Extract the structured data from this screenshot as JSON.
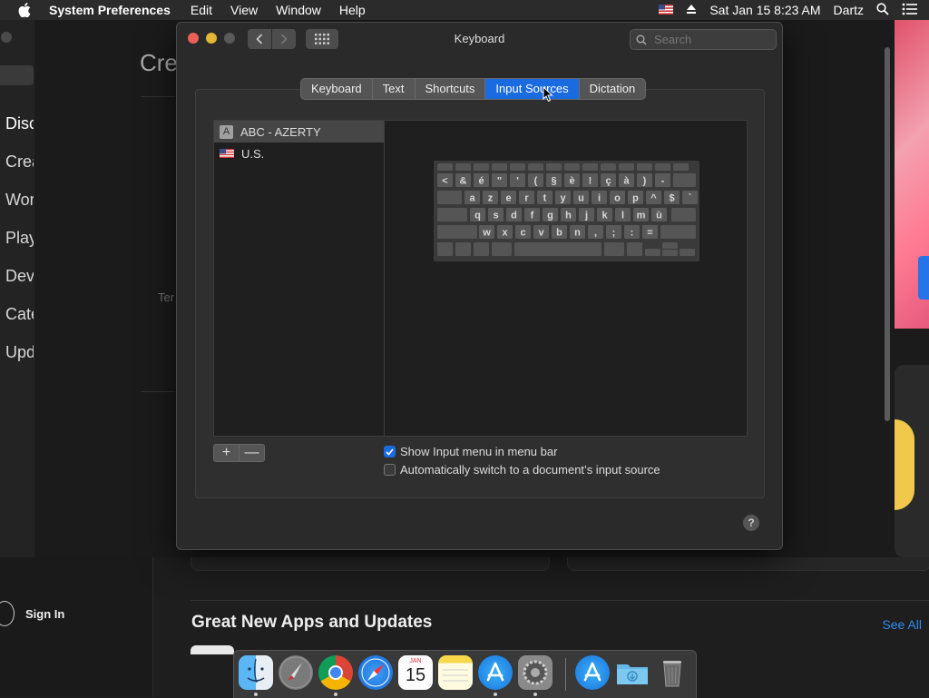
{
  "menubar": {
    "app_name": "System Preferences",
    "items": [
      "Edit",
      "View",
      "Window",
      "Help"
    ],
    "datetime": "Sat Jan 15  8:23 AM",
    "user": "Dartz"
  },
  "background_app": {
    "title_partial": "Cre",
    "nav_items": [
      "Disc",
      "Crea",
      "Wor",
      "Play",
      "Dev",
      "Cate",
      "Upd"
    ],
    "text_partial": "Ter",
    "sign_in": "Sign In",
    "section_title": "Great New Apps and Updates",
    "see_all": "See All"
  },
  "window": {
    "title": "Keyboard",
    "search_placeholder": "Search",
    "tabs": [
      "Keyboard",
      "Text",
      "Shortcuts",
      "Input Sources",
      "Dictation"
    ],
    "active_tab": "Input Sources",
    "input_sources": [
      {
        "label": "ABC - AZERTY",
        "icon": "letter-a-icon",
        "selected": true
      },
      {
        "label": "U.S.",
        "icon": "us-flag-icon",
        "selected": false
      }
    ],
    "add_label": "+",
    "remove_label": "—",
    "show_input_menu": {
      "label": "Show Input menu in menu bar",
      "checked": true
    },
    "auto_switch": {
      "label": "Automatically switch to a document’s input source",
      "checked": false
    },
    "help_label": "?"
  },
  "keyboard_layout": {
    "row1": [
      "<",
      "&",
      "é",
      "\"",
      "'",
      "(",
      "§",
      "è",
      "!",
      "ç",
      "à",
      ")",
      "-"
    ],
    "row2": [
      "a",
      "z",
      "e",
      "r",
      "t",
      "y",
      "u",
      "i",
      "o",
      "p",
      "^",
      "$",
      "`"
    ],
    "row3": [
      "q",
      "s",
      "d",
      "f",
      "g",
      "h",
      "j",
      "k",
      "l",
      "m",
      "ù"
    ],
    "row4": [
      "w",
      "x",
      "c",
      "v",
      "b",
      "n",
      ",",
      ";",
      ":",
      "="
    ]
  },
  "dock": {
    "apps": [
      "Finder",
      "Launchpad",
      "Chrome",
      "Safari",
      "Calendar",
      "Notes",
      "App Store",
      "System Preferences",
      "App Store",
      "Downloads",
      "Trash"
    ],
    "calendar_month": "JAN",
    "calendar_day": "15"
  },
  "colors": {
    "accent": "#1a6ae0",
    "close": "#ed5f57",
    "minimize": "#e3b635",
    "link": "#2e8cf0"
  }
}
